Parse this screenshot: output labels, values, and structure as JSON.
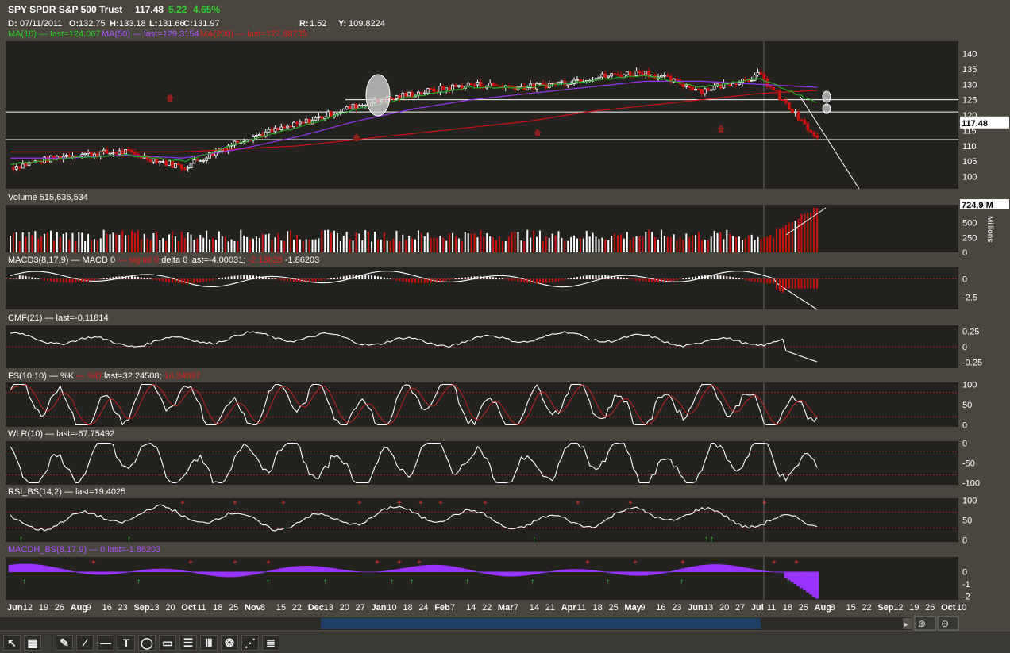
{
  "header": {
    "symbol": "SPY SPDR S&P 500 Trust",
    "last": "117.48",
    "change": "5.22",
    "change_pct": "4.65%",
    "date_label": "D:",
    "date": "07/11/2011",
    "open_label": "O:",
    "open": "132.75",
    "high_label": "H:",
    "high": "133.18",
    "low_label": "L:",
    "low": "131.66",
    "close_label": "C:",
    "close": "131.97",
    "r_label": "R:",
    "r": "1.52",
    "y_label": "Y:",
    "y": "109.8224",
    "ma10": "MA(10) — last=124.067",
    "ma50": "MA(50) — last=129.3154",
    "ma200": "MA(200) — last=127.88735"
  },
  "colors": {
    "bg": "#4a463e",
    "panel": "#23221f",
    "up": "#ffffff",
    "down": "#cc1111",
    "ma10": "#22aa22",
    "ma50": "#9933ee",
    "ma200": "#cc1111",
    "macdh": "#9933ff",
    "accent_green": "#33cc33",
    "guide": "#cc2222"
  },
  "chart_data": [
    {
      "type": "line",
      "name": "price",
      "y_ticks": [
        100,
        105,
        110,
        115,
        120,
        125,
        130,
        135,
        140
      ],
      "ylim": [
        96,
        144
      ],
      "last_label": "117.48",
      "x": [
        "Jun",
        "Jul",
        "Aug",
        "Sep",
        "Oct",
        "Nov",
        "Dec",
        "Jan",
        "Feb",
        "Mar",
        "Apr",
        "May",
        "Jun",
        "Jul",
        "Aug"
      ],
      "close": [
        103,
        107,
        108,
        103,
        112,
        117,
        123,
        127,
        130,
        129,
        132,
        134,
        128,
        133,
        112
      ],
      "ma10": [
        104,
        106,
        107,
        105,
        111,
        116,
        122,
        126,
        129,
        129,
        131,
        133,
        129,
        132,
        124
      ],
      "ma50": [
        106,
        106,
        107,
        106,
        109,
        113,
        118,
        122,
        125,
        127,
        129,
        131,
        131,
        130,
        129
      ],
      "ma200": [
        108,
        108,
        108,
        108,
        109,
        110,
        112,
        114,
        116,
        118,
        121,
        123,
        125,
        127,
        128
      ]
    },
    {
      "type": "bar",
      "name": "volume",
      "title": "Volume 515,636,534",
      "y_ticks": [
        0,
        250,
        500,
        750
      ],
      "ylim": [
        0,
        800
      ],
      "last_label": "724.9 M",
      "unit_label": "Millions"
    },
    {
      "type": "line",
      "name": "macd",
      "title_prefix": "MACD3(8,17,9)",
      "title_parts": [
        "— MACD 0",
        "— signal 0",
        "delta 0 last=-4.00031;",
        "-2.13828",
        "-1.86203"
      ],
      "y_ticks": [
        0,
        -2.5
      ],
      "ylim": [
        -4.2,
        1.6
      ]
    },
    {
      "type": "line",
      "name": "cmf",
      "title": "CMF(21) — last=-0.11814",
      "y_ticks": [
        0.25,
        0,
        -0.25
      ],
      "ylim": [
        -0.35,
        0.35
      ]
    },
    {
      "type": "line",
      "name": "fs",
      "title_prefix": "FS(10,10)",
      "title_parts": [
        "— %K",
        "— %D",
        "last=32.24508;",
        "14.34097"
      ],
      "y_ticks": [
        100,
        50,
        0
      ],
      "ylim": [
        -5,
        105
      ]
    },
    {
      "type": "line",
      "name": "wlr",
      "title": "WLR(10) — last=-67.75492",
      "y_ticks": [
        0,
        -50,
        -100
      ],
      "ylim": [
        -105,
        5
      ]
    },
    {
      "type": "line",
      "name": "rsi",
      "title": "RSI_BS(14,2) — last=19.4025",
      "y_ticks": [
        100,
        50,
        0
      ],
      "ylim": [
        -5,
        105
      ]
    },
    {
      "type": "area",
      "name": "macdh",
      "title": "MACDH_BS(8,17,9) — 0 last=-1.86203",
      "y_ticks": [
        0,
        -1,
        -2
      ],
      "ylim": [
        -2.3,
        1.2
      ]
    }
  ],
  "x_axis": {
    "labels": [
      {
        "t": "Jun",
        "b": true
      },
      {
        "t": "12"
      },
      {
        "t": "19"
      },
      {
        "t": "26"
      },
      {
        "t": "Aug",
        "b": true
      },
      {
        "t": "9"
      },
      {
        "t": "16"
      },
      {
        "t": "23"
      },
      {
        "t": "Sep",
        "b": true
      },
      {
        "t": "13"
      },
      {
        "t": "20"
      },
      {
        "t": "Oct",
        "b": true
      },
      {
        "t": "11"
      },
      {
        "t": "18"
      },
      {
        "t": "25"
      },
      {
        "t": "Nov",
        "b": true
      },
      {
        "t": "8"
      },
      {
        "t": "15"
      },
      {
        "t": "22"
      },
      {
        "t": "Dec",
        "b": true
      },
      {
        "t": "13"
      },
      {
        "t": "20"
      },
      {
        "t": "27"
      },
      {
        "t": "Jan",
        "b": true
      },
      {
        "t": "10"
      },
      {
        "t": "18"
      },
      {
        "t": "24"
      },
      {
        "t": "Feb",
        "b": true
      },
      {
        "t": "7"
      },
      {
        "t": "14"
      },
      {
        "t": "22"
      },
      {
        "t": "Mar",
        "b": true
      },
      {
        "t": "7"
      },
      {
        "t": "14"
      },
      {
        "t": "21"
      },
      {
        "t": "Apr",
        "b": true
      },
      {
        "t": "11"
      },
      {
        "t": "18"
      },
      {
        "t": "25"
      },
      {
        "t": "May",
        "b": true
      },
      {
        "t": "9"
      },
      {
        "t": "16"
      },
      {
        "t": "23"
      },
      {
        "t": "Jun",
        "b": true
      },
      {
        "t": "13"
      },
      {
        "t": "20"
      },
      {
        "t": "27"
      },
      {
        "t": "Jul",
        "b": true
      },
      {
        "t": "11"
      },
      {
        "t": "18"
      },
      {
        "t": "25"
      },
      {
        "t": "Aug",
        "b": true
      },
      {
        "t": "8"
      },
      {
        "t": "15"
      },
      {
        "t": "22"
      },
      {
        "t": "Sep",
        "b": true
      },
      {
        "t": "12"
      },
      {
        "t": "19"
      },
      {
        "t": "26"
      },
      {
        "t": "Oct",
        "b": true
      },
      {
        "t": "10"
      }
    ]
  },
  "toolbar": {
    "tools": [
      {
        "name": "cursor-icon",
        "glyph": "↖"
      },
      {
        "name": "crosshair-icon",
        "glyph": "▦"
      },
      {
        "name": "pen-icon",
        "glyph": "✎"
      },
      {
        "name": "trendline-icon",
        "glyph": "⁄"
      },
      {
        "name": "hline-icon",
        "glyph": "—"
      },
      {
        "name": "text-tool-icon",
        "glyph": "T"
      },
      {
        "name": "ellipse-icon",
        "glyph": "◯"
      },
      {
        "name": "rectangle-icon",
        "glyph": "▭"
      },
      {
        "name": "fib-icon",
        "glyph": "☰"
      },
      {
        "name": "gann-icon",
        "glyph": "Ⅲ"
      },
      {
        "name": "spiral-icon",
        "glyph": "❂"
      },
      {
        "name": "fan-icon",
        "glyph": "⋰"
      },
      {
        "name": "lines-icon",
        "glyph": "≣"
      }
    ]
  }
}
